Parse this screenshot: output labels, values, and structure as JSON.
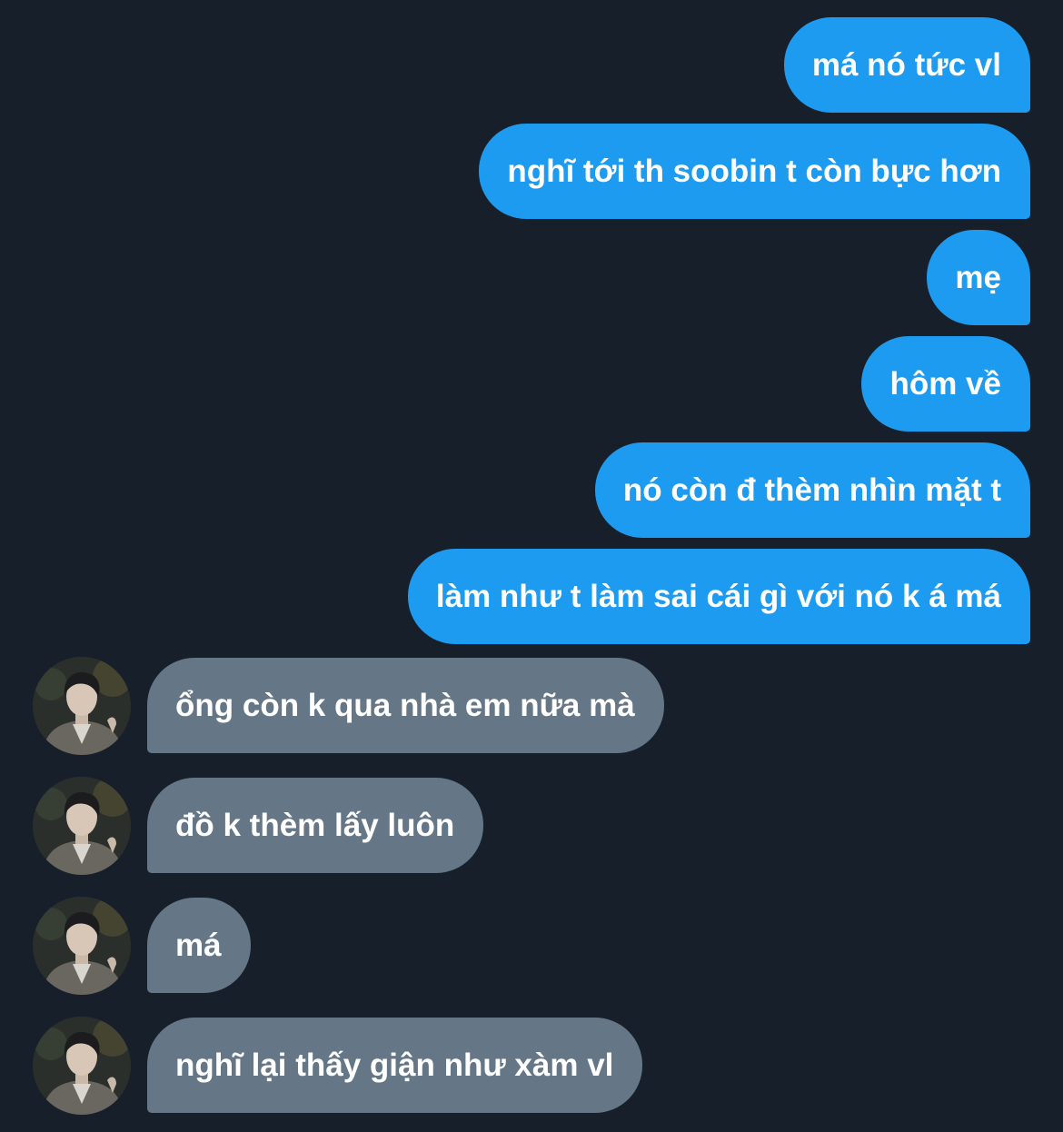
{
  "conversation": {
    "sent_messages": [
      "má nó tức vl",
      "nghĩ tới th soobin t còn bực hơn",
      "mẹ",
      "hôm về",
      "nó còn đ thèm nhìn mặt t",
      "làm như t làm sai cái gì với nó k á má"
    ],
    "received_messages": [
      "ổng còn k qua nhà em nữa mà",
      "đồ k thèm lấy luôn",
      "má",
      "nghĩ lại thấy giận như xàm vl"
    ]
  },
  "icons": {
    "avatar": "user-avatar-photo"
  },
  "colors": {
    "background": "#17202a",
    "sent_bubble": "#1d9bf0",
    "received_bubble": "#657786",
    "text": "#ffffff"
  }
}
